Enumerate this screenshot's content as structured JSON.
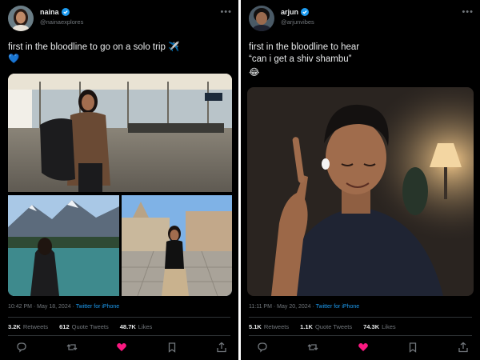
{
  "tweets": [
    {
      "display_name": "naina",
      "handle": "@nainaexplores",
      "text_line1": "first in the bloodline to go on a solo trip ✈️",
      "text_line2": "💙",
      "timestamp": "10:42 PM · May 18, 2024 · ",
      "client": "Twitter for iPhone",
      "retweets": "3.2K",
      "retweets_label": "Retweets",
      "quotes": "612",
      "quotes_label": "Quote Tweets",
      "likes": "48.7K",
      "likes_label": "Likes"
    },
    {
      "display_name": "arjun",
      "handle": "@arjunvibes",
      "text_line1": "first in the bloodline to hear",
      "text_line2": "“can i get a shiv shambu”",
      "text_line3": "😂",
      "timestamp": "11:11 PM · May 20, 2024 · ",
      "client": "Twitter for iPhone",
      "retweets": "5.1K",
      "retweets_label": "Retweets",
      "quotes": "1.1K",
      "quotes_label": "Quote Tweets",
      "likes": "74.3K",
      "likes_label": "Likes"
    }
  ],
  "icons": {
    "more": "more-horizontal-icon",
    "reply": "reply-icon",
    "retweet": "retweet-icon",
    "like": "heart-icon",
    "bookmark": "bookmark-icon",
    "share": "share-icon"
  },
  "colors": {
    "background": "#000000",
    "text": "#e7e9ea",
    "muted": "#71767b",
    "link": "#1d9bf0",
    "verified": "#1d9bf0",
    "like": "#f91880"
  }
}
